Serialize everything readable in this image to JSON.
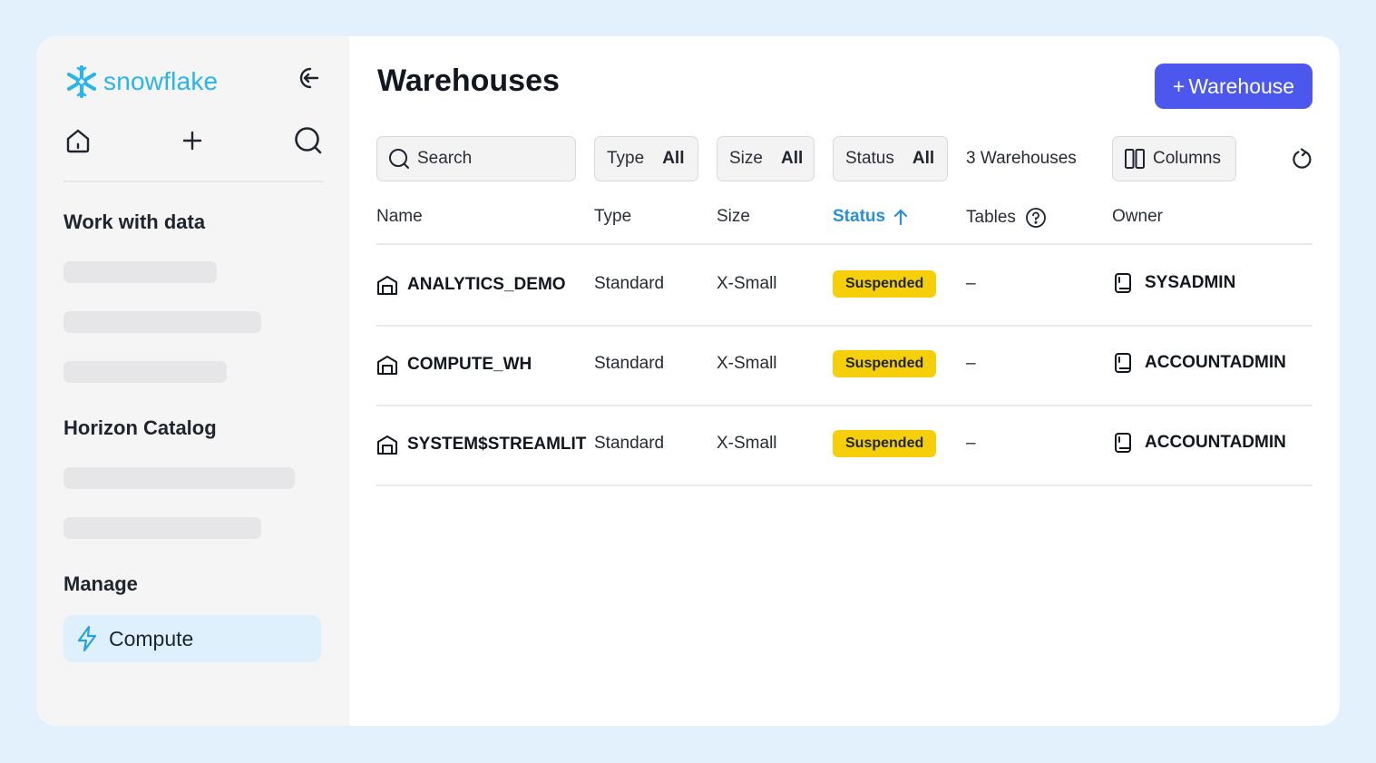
{
  "brand": {
    "name": "snowflake",
    "color": "#29b5e8"
  },
  "sidebar": {
    "sections": [
      {
        "title": "Work with data"
      },
      {
        "title": "Horizon Catalog"
      },
      {
        "title": "Manage"
      }
    ],
    "active_item": {
      "label": "Compute",
      "icon": "bolt-icon"
    },
    "icons": [
      "home-icon",
      "plus-icon",
      "search-icon",
      "collapse-icon"
    ]
  },
  "page": {
    "title": "Warehouses",
    "add_button": {
      "plus": "+",
      "label": "Warehouse"
    }
  },
  "toolbar": {
    "search_placeholder": "Search",
    "filters": [
      {
        "label": "Type",
        "value": "All"
      },
      {
        "label": "Size",
        "value": "All"
      },
      {
        "label": "Status",
        "value": "All"
      }
    ],
    "count": "3 Warehouses",
    "columns_label": "Columns"
  },
  "table": {
    "headers": [
      "Name",
      "Type",
      "Size",
      "Status",
      "Tables",
      "Owner"
    ],
    "sorted_by": "Status",
    "rows": [
      {
        "name": "ANALYTICS_DEMO",
        "type": "Standard",
        "size": "X-Small",
        "status": "Suspended",
        "tables": "–",
        "owner": "SYSADMIN"
      },
      {
        "name": "COMPUTE_WH",
        "type": "Standard",
        "size": "X-Small",
        "status": "Suspended",
        "tables": "–",
        "owner": "ACCOUNTADMIN"
      },
      {
        "name": "SYSTEM$STREAMLIT",
        "type": "Standard",
        "size": "X-Small",
        "status": "Suspended",
        "tables": "–",
        "owner": "ACCOUNTADMIN"
      }
    ]
  },
  "colors": {
    "accent": "#4c57ee",
    "status_suspended": "#f5cf0a",
    "sort_active": "#2b8fd6"
  }
}
